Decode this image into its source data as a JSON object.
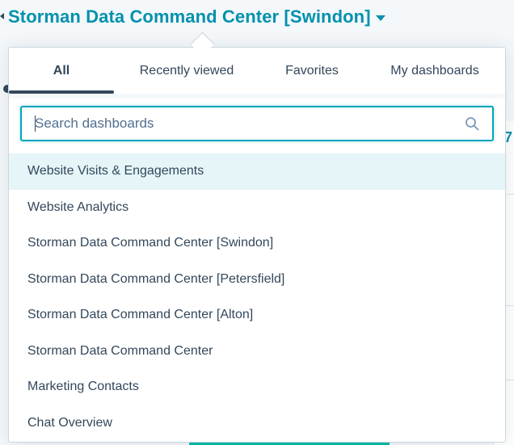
{
  "header": {
    "title": "Storman Data Command Center [Swindon]"
  },
  "background": {
    "edge_number": "7"
  },
  "dropdown": {
    "tabs": [
      {
        "label": "All",
        "active": true
      },
      {
        "label": "Recently viewed",
        "active": false
      },
      {
        "label": "Favorites",
        "active": false
      },
      {
        "label": "My dashboards",
        "active": false
      }
    ],
    "search": {
      "placeholder": "Search dashboards",
      "value": ""
    },
    "items": [
      {
        "label": "Website Visits & Engagements",
        "highlighted": true
      },
      {
        "label": "Website Analytics",
        "highlighted": false
      },
      {
        "label": "Storman Data Command Center [Swindon]",
        "highlighted": false
      },
      {
        "label": "Storman Data Command Center [Petersfield]",
        "highlighted": false
      },
      {
        "label": "Storman Data Command Center [Alton]",
        "highlighted": false
      },
      {
        "label": "Storman Data Command Center",
        "highlighted": false
      },
      {
        "label": "Marketing Contacts",
        "highlighted": false
      },
      {
        "label": "Chat Overview",
        "highlighted": false
      }
    ]
  },
  "colors": {
    "accent": "#0091ae",
    "text": "#33475b",
    "highlight": "#e5f5f8",
    "focus_border": "#00a4bd"
  },
  "icons": {
    "search": "search-icon",
    "title_dropdown": "caret-down-icon"
  }
}
